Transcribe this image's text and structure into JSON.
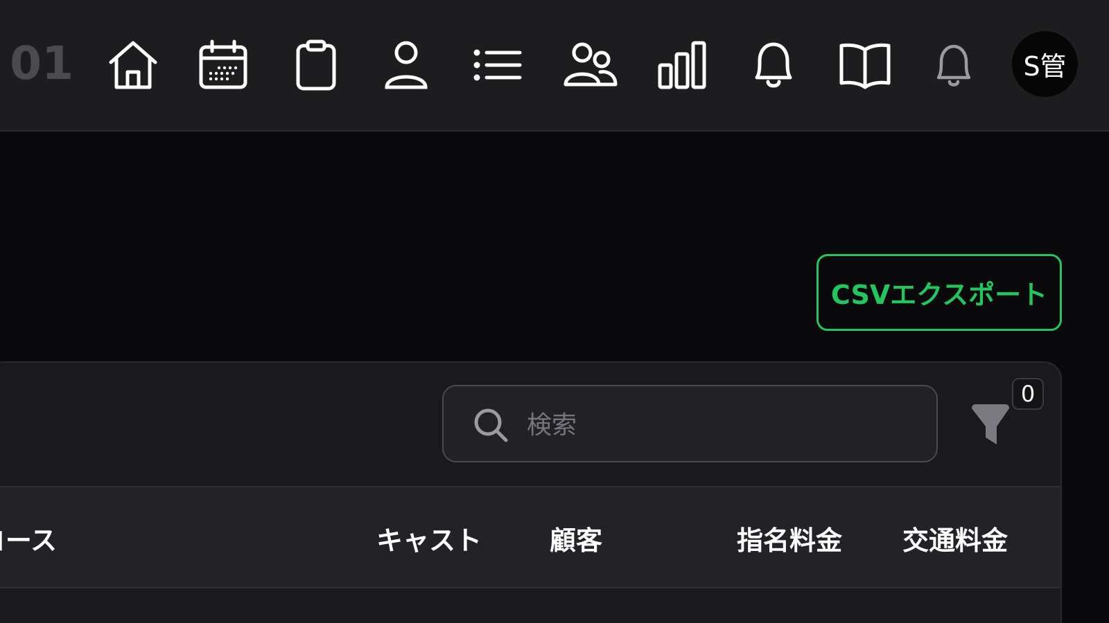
{
  "header": {
    "brand_fragment": "/ 01",
    "nav": [
      {
        "name": "home-icon"
      },
      {
        "name": "calendar-icon"
      },
      {
        "name": "clipboard-icon"
      },
      {
        "name": "user-icon"
      },
      {
        "name": "list-icon"
      },
      {
        "name": "users-icon"
      },
      {
        "name": "bar-chart-icon"
      },
      {
        "name": "bell-icon"
      },
      {
        "name": "book-icon"
      },
      {
        "name": "bell-muted-icon"
      }
    ],
    "avatar_label": "S管"
  },
  "toolbar": {
    "csv_export_label": "CSVエクスポート"
  },
  "search": {
    "placeholder": "検索",
    "value": ""
  },
  "filter": {
    "icon": "filter-icon",
    "count": "0"
  },
  "table": {
    "columns": [
      "コース",
      "キャスト",
      "顧客",
      "指名料金",
      "交通料金"
    ]
  },
  "colors": {
    "accent": "#22c55e",
    "topbar_bg": "#1d1d20",
    "page_bg": "#0a0a0c",
    "card_bg": "#1a1a1d",
    "header_row_bg": "#232327"
  }
}
